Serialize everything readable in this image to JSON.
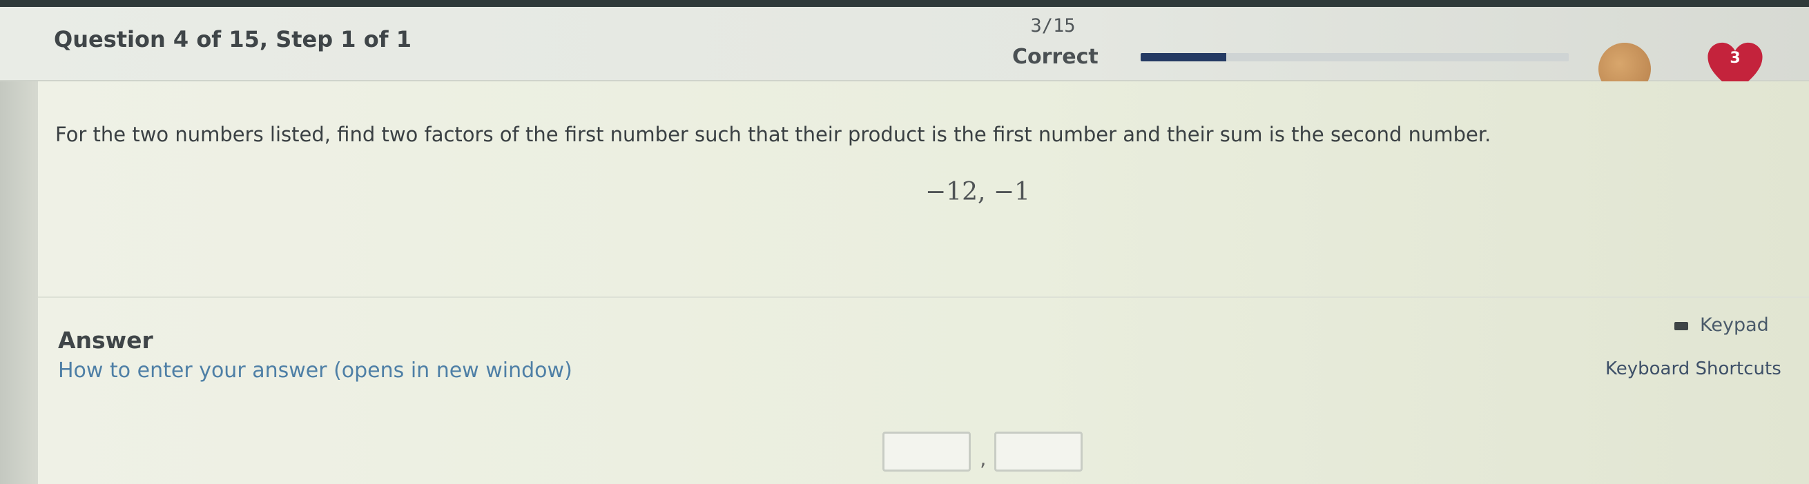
{
  "header": {
    "question_title": "Question 4 of 15, Step 1 of 1",
    "score_text": "3/15",
    "status_text": "Correct",
    "progress_fraction": 0.2,
    "heart_count": "3"
  },
  "question": {
    "prompt": "For the two numbers listed, find two factors of the first number such that their product is the first number and their sum is the second number.",
    "numbers": "−12, −1"
  },
  "answer": {
    "label": "Answer",
    "howto_link": "How to enter your answer (opens in new window)",
    "keypad_label": "Keypad",
    "shortcuts_label": "Keyboard Shortcuts",
    "box1_value": "",
    "box2_value": "",
    "separator": ","
  },
  "colors": {
    "progress_fill": "#243a63",
    "link": "#4e7fa6",
    "heart": "#c4233c"
  },
  "icons": [
    "avatar",
    "heart-icon",
    "keypad-icon"
  ]
}
